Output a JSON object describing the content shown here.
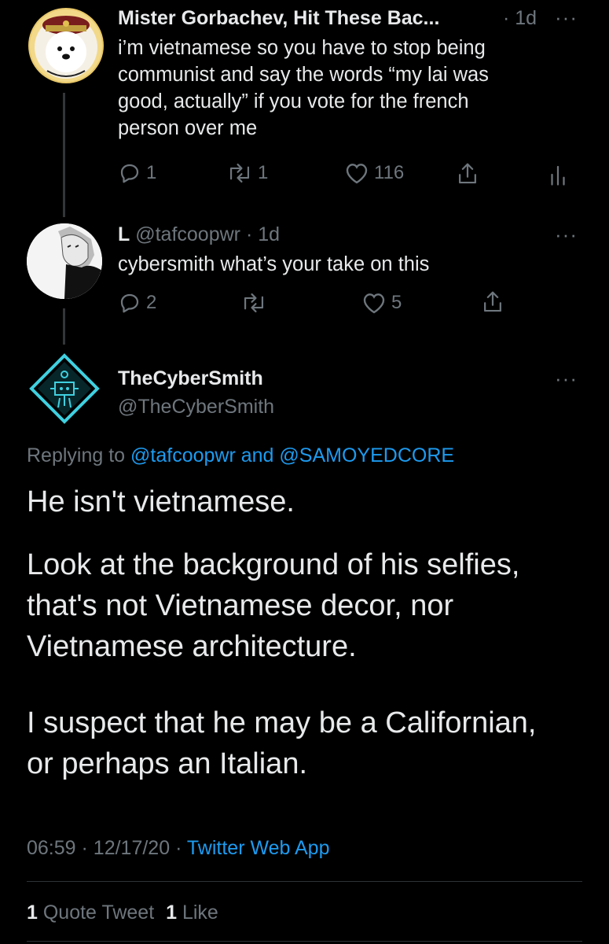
{
  "tweet1": {
    "name": "Mister Gorbachev, Hit These Bac...",
    "dot": "·",
    "time": "1d",
    "lines": [
      "i’m vietnamese so you have to stop being",
      "communist and say the words “my lai was",
      "good, actually” if you vote for the french",
      "person over me"
    ],
    "replies": "1",
    "retweets": "1",
    "likes": "116",
    "more": "···"
  },
  "tweet2": {
    "name": "L",
    "handle": "@tafcoopwr",
    "dot": "·",
    "time": "1d",
    "text": "cybersmith what’s your take on this",
    "replies": "2",
    "likes": "5",
    "more": "···"
  },
  "main": {
    "name": "TheCyberSmith",
    "handle": "@TheCyberSmith",
    "more": "···",
    "replying_prefix": "Replying to",
    "replying_to_1": "@tafcoopwr",
    "replying_and": "and",
    "replying_to_2": "@SAMOYEDCORE",
    "para1": "He isn't vietnamese.",
    "para2_lines": [
      "Look at the background of his selfies,",
      "that's not Vietnamese decor, nor",
      "Vietnamese architecture."
    ],
    "para3_lines": [
      "I suspect that he may be a Californian,",
      "or perhaps an Italian."
    ],
    "time": "06:59",
    "dot1": "·",
    "date": "12/17/20",
    "dot2": "·",
    "source": "Twitter Web App",
    "quote_count": "1",
    "quote_label": "Quote Tweet",
    "like_count": "1",
    "like_label": "Like"
  },
  "colors": {
    "background": "#000000",
    "link": "#1d9bf0",
    "muted": "#6e767d",
    "text": "#e7e9ea"
  },
  "icons": {
    "reply": "reply-icon",
    "retweet": "retweet-icon",
    "like": "heart-icon",
    "share": "share-icon",
    "analytics": "analytics-icon",
    "more": "more-icon"
  }
}
